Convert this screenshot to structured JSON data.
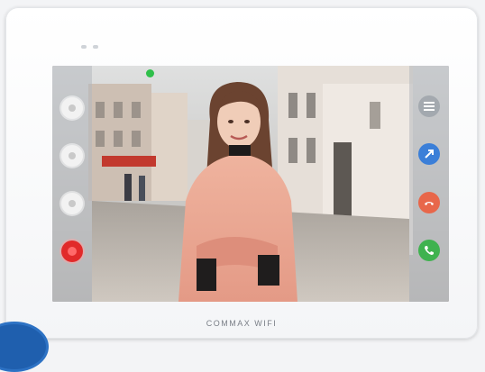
{
  "device": {
    "brand_text": "COMMAX WIFI"
  },
  "controls": {
    "left": [
      {
        "icon": "menu-dot-icon",
        "style": "white"
      },
      {
        "icon": "volume-dot-icon",
        "style": "white"
      },
      {
        "icon": "capture-icon",
        "style": "white"
      },
      {
        "icon": "record-icon",
        "style": "red"
      }
    ],
    "right": [
      {
        "icon": "list-menu-icon",
        "style": "gray"
      },
      {
        "icon": "door-open-icon",
        "style": "blue"
      },
      {
        "icon": "hang-up-icon",
        "style": "orange"
      },
      {
        "icon": "call-phone-icon",
        "style": "green"
      }
    ]
  },
  "status": {
    "icon": "online-status-icon",
    "color": "#2fbf4a"
  }
}
